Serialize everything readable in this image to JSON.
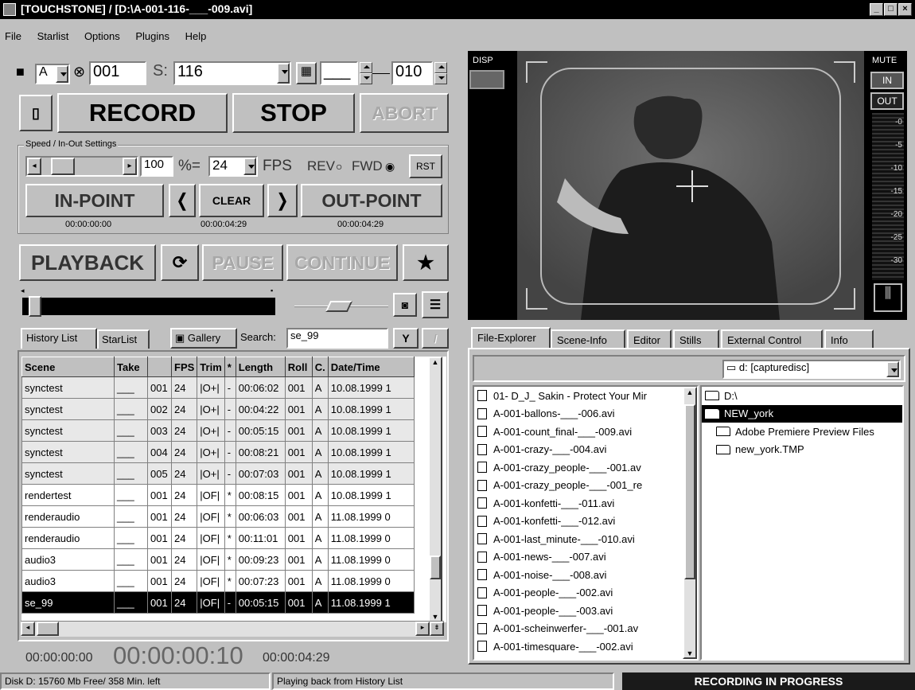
{
  "window": {
    "title": "[TOUCHSTONE] / [D:\\A-001-116-___-009.avi]",
    "buttons": [
      "_",
      "□",
      "×"
    ]
  },
  "menu": [
    "File",
    "Starlist",
    "Options",
    "Plugins",
    "Help"
  ],
  "toolbar": {
    "camera": "A",
    "reel": "001",
    "scene_label": "S:",
    "scene": "116",
    "take": "___",
    "take_num": "010"
  },
  "transport": {
    "record": "RECORD",
    "stop": "STOP",
    "abort": "ABORT"
  },
  "speed": {
    "group_label": "Speed / In-Out Settings",
    "percent": "100",
    "percent_label": "%=",
    "fps": "24",
    "fps_label": "FPS",
    "rev": "REV",
    "fwd": "FWD",
    "rst": "RST",
    "in_point": "IN-POINT",
    "clear": "CLEAR",
    "out_point": "OUT-POINT",
    "in_time": "00:00:00:00",
    "mid_time": "00:00:04:29",
    "out_time": "00:00:04:29",
    "prev": "❬",
    "next": "❭"
  },
  "playback": {
    "playback": "PLAYBACK",
    "pause": "PAUSE",
    "continue": "CONTINUE",
    "star": "★"
  },
  "history_tabs": {
    "history": "History List",
    "starlist": "StarList",
    "gallery": "Gallery",
    "search_label": "Search:",
    "search_value": "se_99"
  },
  "history": {
    "columns": [
      "Scene",
      "Take",
      "",
      "FPS",
      "Trim",
      "*",
      "Length",
      "Roll",
      "C.",
      "Date/Time"
    ],
    "rows": [
      [
        "synctest",
        "___",
        "001",
        "24",
        "|O+|",
        "-",
        "00:06:02",
        "001",
        "A",
        "10.08.1999 1"
      ],
      [
        "synctest",
        "___",
        "002",
        "24",
        "|O+|",
        "-",
        "00:04:22",
        "001",
        "A",
        "10.08.1999 1"
      ],
      [
        "synctest",
        "___",
        "003",
        "24",
        "|O+|",
        "-",
        "00:05:15",
        "001",
        "A",
        "10.08.1999 1"
      ],
      [
        "synctest",
        "___",
        "004",
        "24",
        "|O+|",
        "-",
        "00:08:21",
        "001",
        "A",
        "10.08.1999 1"
      ],
      [
        "synctest",
        "___",
        "005",
        "24",
        "|O+|",
        "-",
        "00:07:03",
        "001",
        "A",
        "10.08.1999 1"
      ],
      [
        "rendertest",
        "___",
        "001",
        "24",
        "|OF|",
        "*",
        "00:08:15",
        "001",
        "A",
        "10.08.1999 1"
      ],
      [
        "renderaudio",
        "___",
        "001",
        "24",
        "|OF|",
        "*",
        "00:06:03",
        "001",
        "A",
        "11.08.1999 0"
      ],
      [
        "renderaudio",
        "___",
        "001",
        "24",
        "|OF|",
        "*",
        "00:11:01",
        "001",
        "A",
        "11.08.1999 0"
      ],
      [
        "audio3",
        "___",
        "001",
        "24",
        "|OF|",
        "*",
        "00:09:23",
        "001",
        "A",
        "11.08.1999 0"
      ],
      [
        "audio3",
        "___",
        "001",
        "24",
        "|OF|",
        "*",
        "00:07:23",
        "001",
        "A",
        "11.08.1999 0"
      ],
      [
        "se_99",
        "___",
        "001",
        "24",
        "|OF|",
        "-",
        "00:05:15",
        "001",
        "A",
        "11.08.1999 1"
      ]
    ]
  },
  "timecode": {
    "left": "00:00:00:00",
    "big": "00:00:00:10",
    "right": "00:00:04:29"
  },
  "status": {
    "disk": "Disk D:   15760 Mb Free/ 358 Min. left",
    "message": "Playing back from History List",
    "recording": "RECORDING IN PROGRESS"
  },
  "preview": {
    "disp": "DISP",
    "mute": "MUTE",
    "in": "IN",
    "out": "OUT",
    "scale": [
      "-0",
      "-5",
      "-10",
      "-15",
      "-20",
      "-25",
      "-30"
    ]
  },
  "right_tabs": [
    "File-Explorer",
    "Scene-Info",
    "Editor",
    "Stills",
    "External Control",
    "Info"
  ],
  "drive": "d: [capturedisc]",
  "files": [
    "01- D_J_ Sakin - Protect Your Mir",
    "A-001-ballons-___-006.avi",
    "A-001-count_final-___-009.avi",
    "A-001-crazy-___-004.avi",
    "A-001-crazy_people-___-001.av",
    "A-001-crazy_people-___-001_re",
    "A-001-konfetti-___-011.avi",
    "A-001-konfetti-___-012.avi",
    "A-001-last_minute-___-010.avi",
    "A-001-news-___-007.avi",
    "A-001-noise-___-008.avi",
    "A-001-people-___-002.avi",
    "A-001-people-___-003.avi",
    "A-001-scheinwerfer-___-001.av",
    "A-001-timesquare-___-002.avi"
  ],
  "folders": [
    "D:\\",
    "NEW_york",
    "Adobe Premiere Preview Files",
    "new_york.TMP"
  ],
  "colors": {
    "face": "#c0c0c0",
    "title": "#000000",
    "preview": "#5a5a5a",
    "status_black": "#1a1a1a"
  }
}
